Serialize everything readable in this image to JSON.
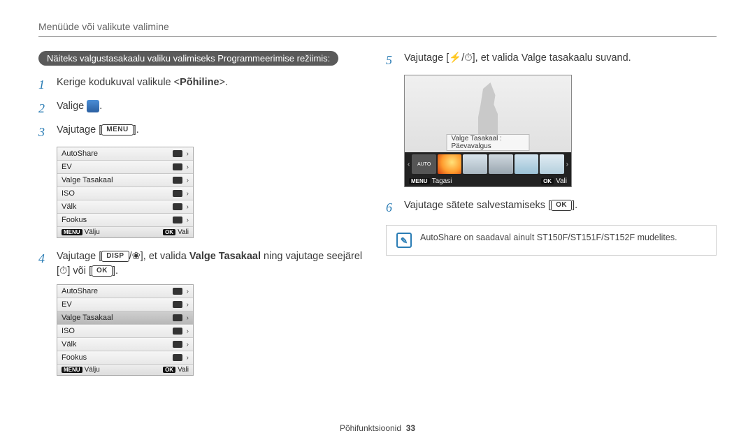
{
  "header": {
    "title": "Menüüde või valikute valimine"
  },
  "pill": "Näiteks valgustasakaalu valiku valimiseks Programmeerimise režiimis:",
  "steps": {
    "1": {
      "num": "1",
      "pre": "Kerige kodukuval valikule <",
      "bold": "Põhiline",
      "post": ">."
    },
    "2": {
      "num": "2",
      "pre": "Valige ",
      "post": "."
    },
    "3": {
      "num": "3",
      "pre": "Vajutage [",
      "chip": "MENU",
      "post": "]."
    },
    "4": {
      "num": "4",
      "pre": "Vajutage [",
      "chip1": "DISP",
      "mid": "], et valida ",
      "bold": "Valge Tasakaal",
      "post1": " ning vajutage seejärel",
      "line2a": "[",
      "line2b": "] või [",
      "chip2": "OK",
      "line2c": "]."
    },
    "5": {
      "num": "5",
      "pre": "Vajutage [",
      "mid": "], et valida Valge tasakaalu suvand."
    },
    "6": {
      "num": "6",
      "pre": "Vajutage sätete salvestamiseks [",
      "chip": "OK",
      "post": "]."
    }
  },
  "menu1": {
    "rows": [
      {
        "label": "AutoShare"
      },
      {
        "label": "EV"
      },
      {
        "label": "Valge Tasakaal"
      },
      {
        "label": "ISO"
      },
      {
        "label": "Välk"
      },
      {
        "label": "Fookus"
      }
    ],
    "foot": {
      "left_chip": "MENU",
      "left": "Välju",
      "right_chip": "OK",
      "right": "Vali"
    }
  },
  "menu2": {
    "rows": [
      {
        "label": "AutoShare"
      },
      {
        "label": "EV"
      },
      {
        "label": "Valge Tasakaal"
      },
      {
        "label": "ISO"
      },
      {
        "label": "Välk"
      },
      {
        "label": "Fookus"
      }
    ],
    "selected_index": 2,
    "foot": {
      "left_chip": "MENU",
      "left": "Välju",
      "right_chip": "OK",
      "right": "Vali"
    }
  },
  "preview": {
    "label": "Valge Tasakaal : Päevavalgus",
    "auto_badge": "AUTO",
    "foot": {
      "left_chip": "MENU",
      "left": "Tagasi",
      "right_chip": "OK",
      "right": "Vali"
    }
  },
  "note": {
    "text": "AutoShare on saadaval ainult ST150F/ST151F/ST152F mudelites."
  },
  "footer": {
    "label": "Põhifunktsioonid",
    "page": "33"
  },
  "icons": {
    "flash": "⚡",
    "timer": "⏱",
    "macro": "❀",
    "slash": "/"
  }
}
